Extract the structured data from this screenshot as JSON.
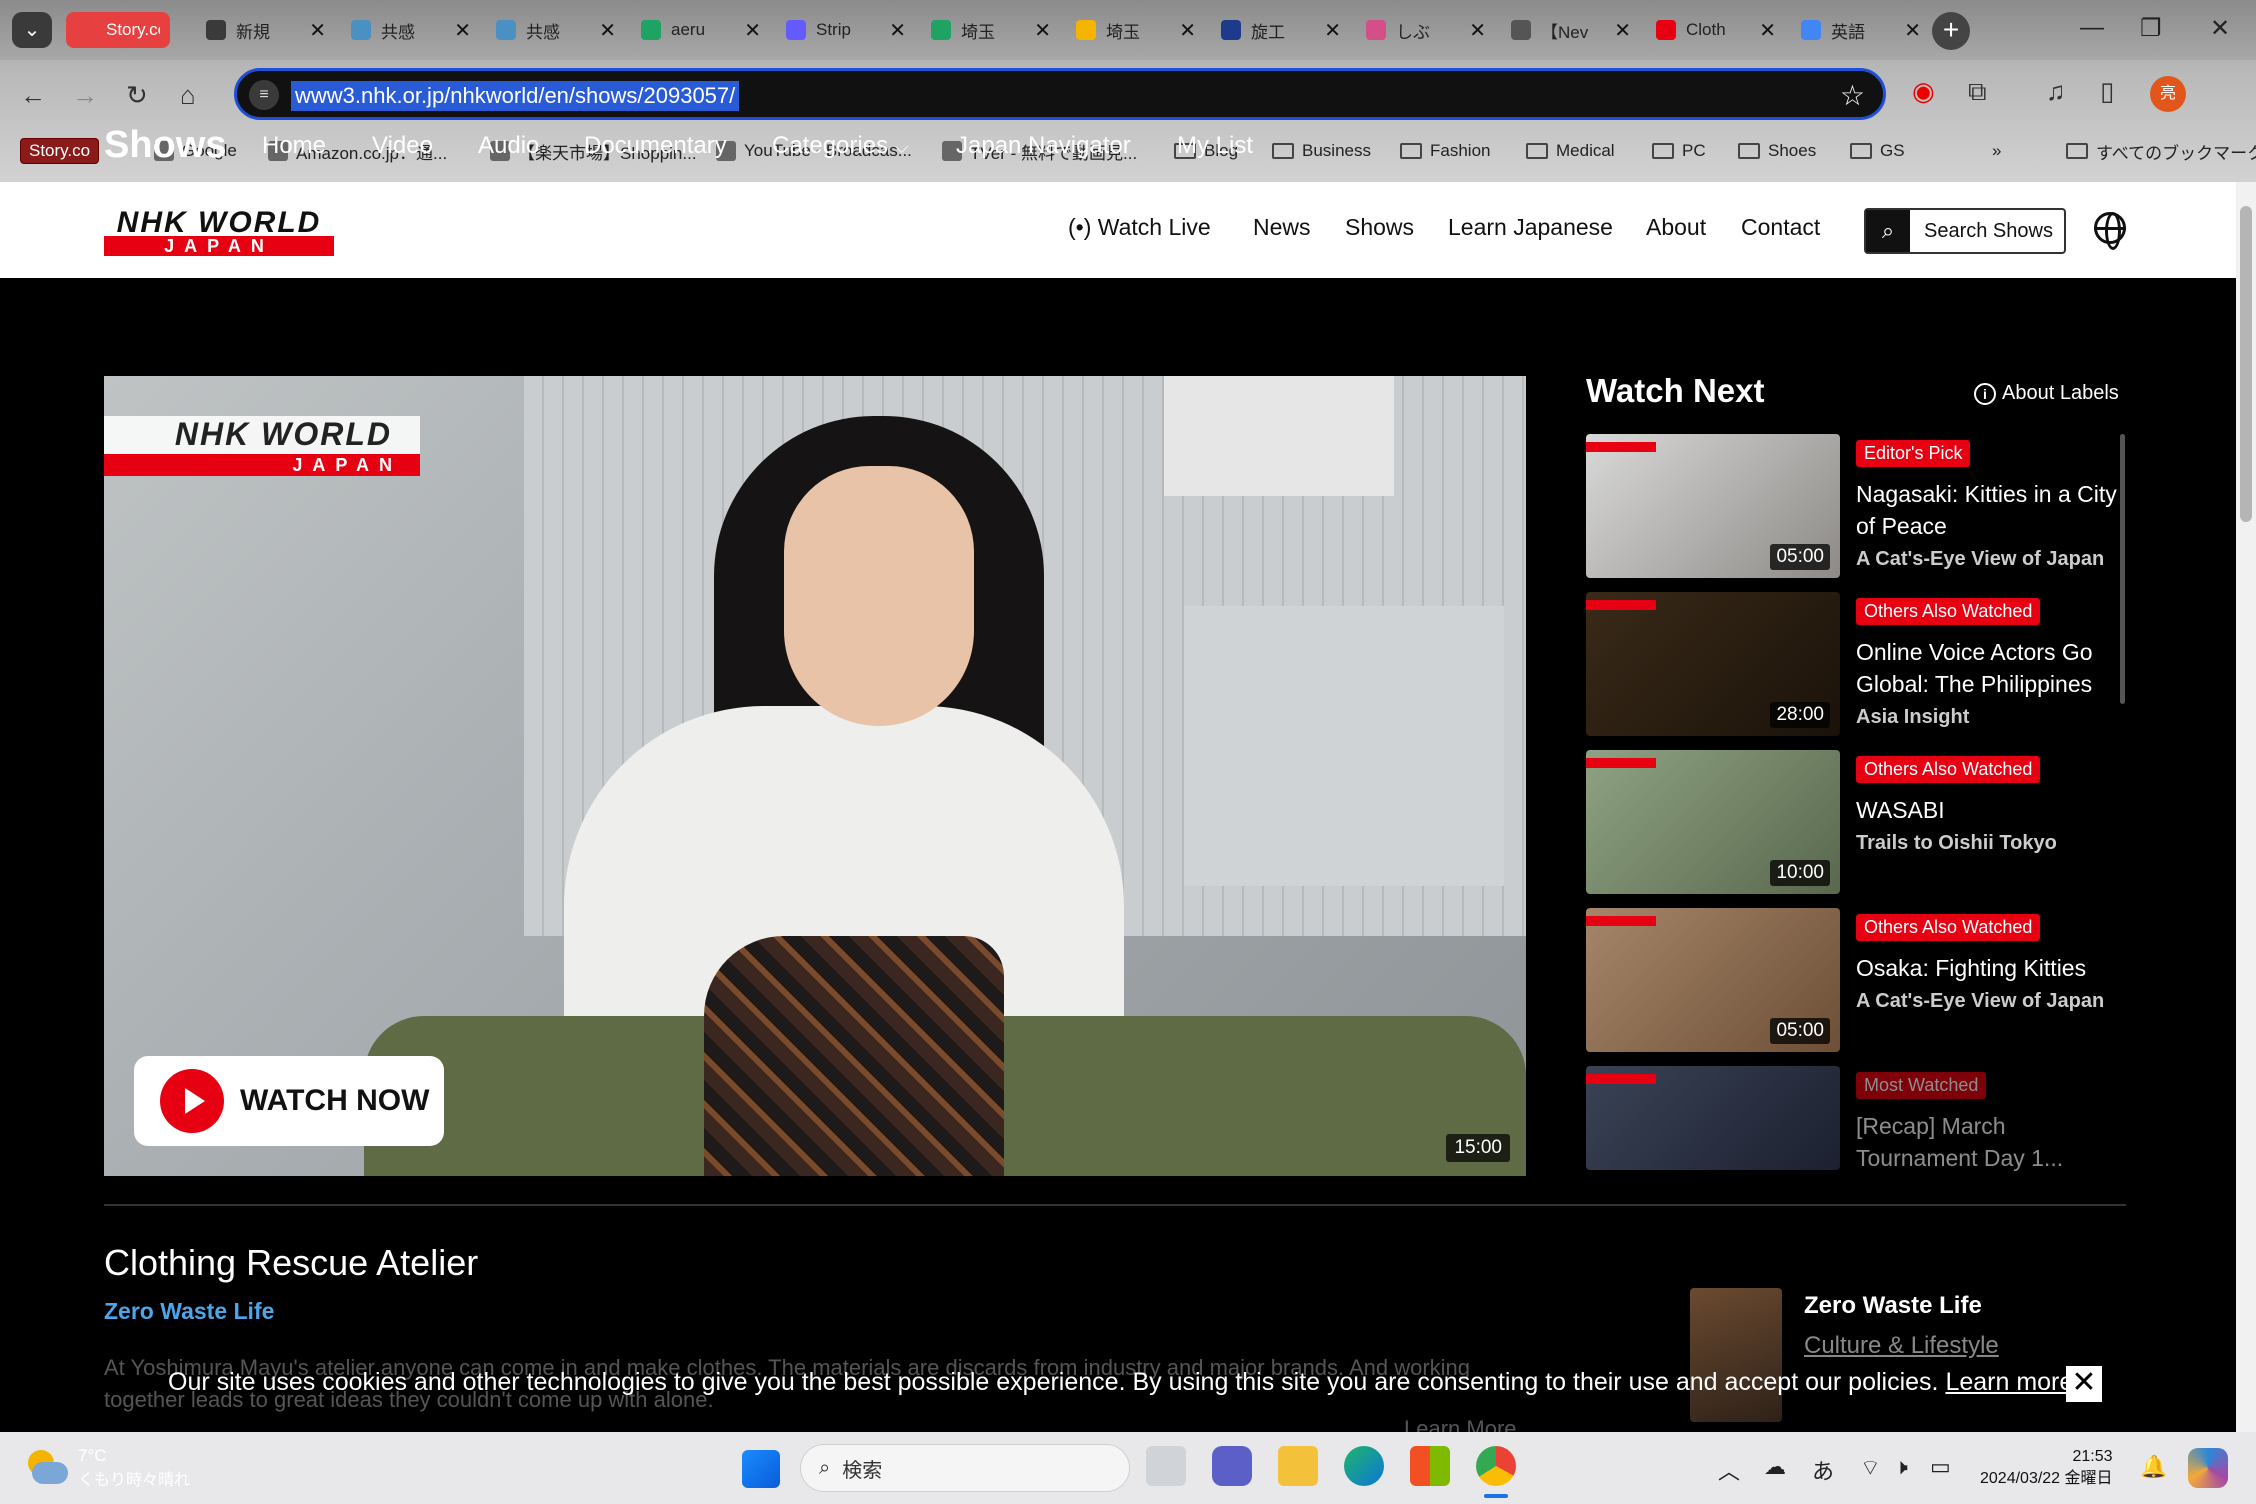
{
  "browser": {
    "tabs": [
      {
        "title": "Story.co",
        "active": true,
        "color": "#e64040"
      },
      {
        "title": "新規",
        "color": "#3a3a3a"
      },
      {
        "title": "共感",
        "color": "#4a90c2"
      },
      {
        "title": "共感",
        "color": "#4a90c2"
      },
      {
        "title": "aeru",
        "color": "#1ea362"
      },
      {
        "title": "Strip",
        "color": "#635bff"
      },
      {
        "title": "埼玉",
        "color": "#1ea362"
      },
      {
        "title": "埼玉",
        "color": "#f4b400"
      },
      {
        "title": "旋工",
        "color": "#1e3a8a"
      },
      {
        "title": "しぶ",
        "color": "#d44f8a"
      },
      {
        "title": "【Nev",
        "color": "#555555"
      },
      {
        "title": "Cloth",
        "color": "#e60012"
      },
      {
        "title": "英語",
        "color": "#4285f4"
      }
    ],
    "url": "www3.nhk.or.jp/nhkworld/en/shows/2093057/",
    "profile_initial": "亮",
    "bookmarks": [
      {
        "label": "Story.co",
        "type": "badge"
      },
      {
        "label": "Google",
        "type": "site"
      },
      {
        "label": "Amazon.co.jp：通...",
        "type": "site"
      },
      {
        "label": "【楽天市場】Shoppin...",
        "type": "site"
      },
      {
        "label": "YouTube - Broadcas...",
        "type": "site"
      },
      {
        "label": "TVer - 無料で動画見...",
        "type": "site"
      },
      {
        "label": "Blog",
        "type": "folder"
      },
      {
        "label": "Business",
        "type": "folder"
      },
      {
        "label": "Fashion",
        "type": "folder"
      },
      {
        "label": "Medical",
        "type": "folder"
      },
      {
        "label": "PC",
        "type": "folder"
      },
      {
        "label": "Shoes",
        "type": "folder"
      },
      {
        "label": "GS",
        "type": "folder"
      }
    ],
    "all_bookmarks": "すべてのブックマーク",
    "more_chevron": "»"
  },
  "site": {
    "logo_top": "NHK WORLD",
    "logo_bottom": "JAPAN",
    "nav": [
      "Watch Live",
      "News",
      "Shows",
      "Learn Japanese",
      "About",
      "Contact"
    ],
    "watch_live_icon": "(•)",
    "search_label": "Search Shows"
  },
  "shows": {
    "title": "Shows",
    "subnav": [
      "Home",
      "Video",
      "Audio",
      "Documentary",
      "Categories",
      "Japan Navigator",
      "My List"
    ]
  },
  "hero": {
    "watch_now": "WATCH NOW",
    "duration": "15:00"
  },
  "watch_next": {
    "title": "Watch Next",
    "about_labels": "About Labels",
    "items": [
      {
        "label": "Editor's Pick",
        "title": "Nagasaki: Kitties in a City of Peace",
        "series": "A Cat's-Eye View of Japan",
        "duration": "05:00"
      },
      {
        "label": "Others Also Watched",
        "title": "Online Voice Actors Go Global: The Philippines",
        "series": "Asia Insight",
        "duration": "28:00"
      },
      {
        "label": "Others Also Watched",
        "title": "WASABI",
        "series": "Trails to Oishii Tokyo",
        "duration": "10:00"
      },
      {
        "label": "Others Also Watched",
        "title": "Osaka: Fighting Kitties",
        "series": "A Cat's-Eye View of Japan",
        "duration": "05:00"
      },
      {
        "label": "Most Watched",
        "title": "[Recap] March Tournament Day 1...",
        "series": "",
        "duration": ""
      }
    ]
  },
  "episode": {
    "title": "Clothing Rescue Atelier",
    "series": "Zero Waste Life",
    "description": "At Yoshimura Mayu's atelier anyone can come in and make clothes. The materials are discards from industry and major brands. And working together leads to great ideas they couldn't come up with alone.",
    "learn_more": "Learn More",
    "side_title": "Zero Waste Life",
    "side_category": "Culture & Lifestyle"
  },
  "cookie": {
    "text": "Our site uses cookies and other technologies to give you the best possible experience. By using this site you are consenting to their use and accept our policies.",
    "link": "Learn more...",
    "close": "✕"
  },
  "taskbar": {
    "temp": "7°C",
    "weather": "くもり時々晴れ",
    "search": "検索",
    "ime": "あ",
    "time": "21:53",
    "date": "2024/03/22 金曜日"
  }
}
